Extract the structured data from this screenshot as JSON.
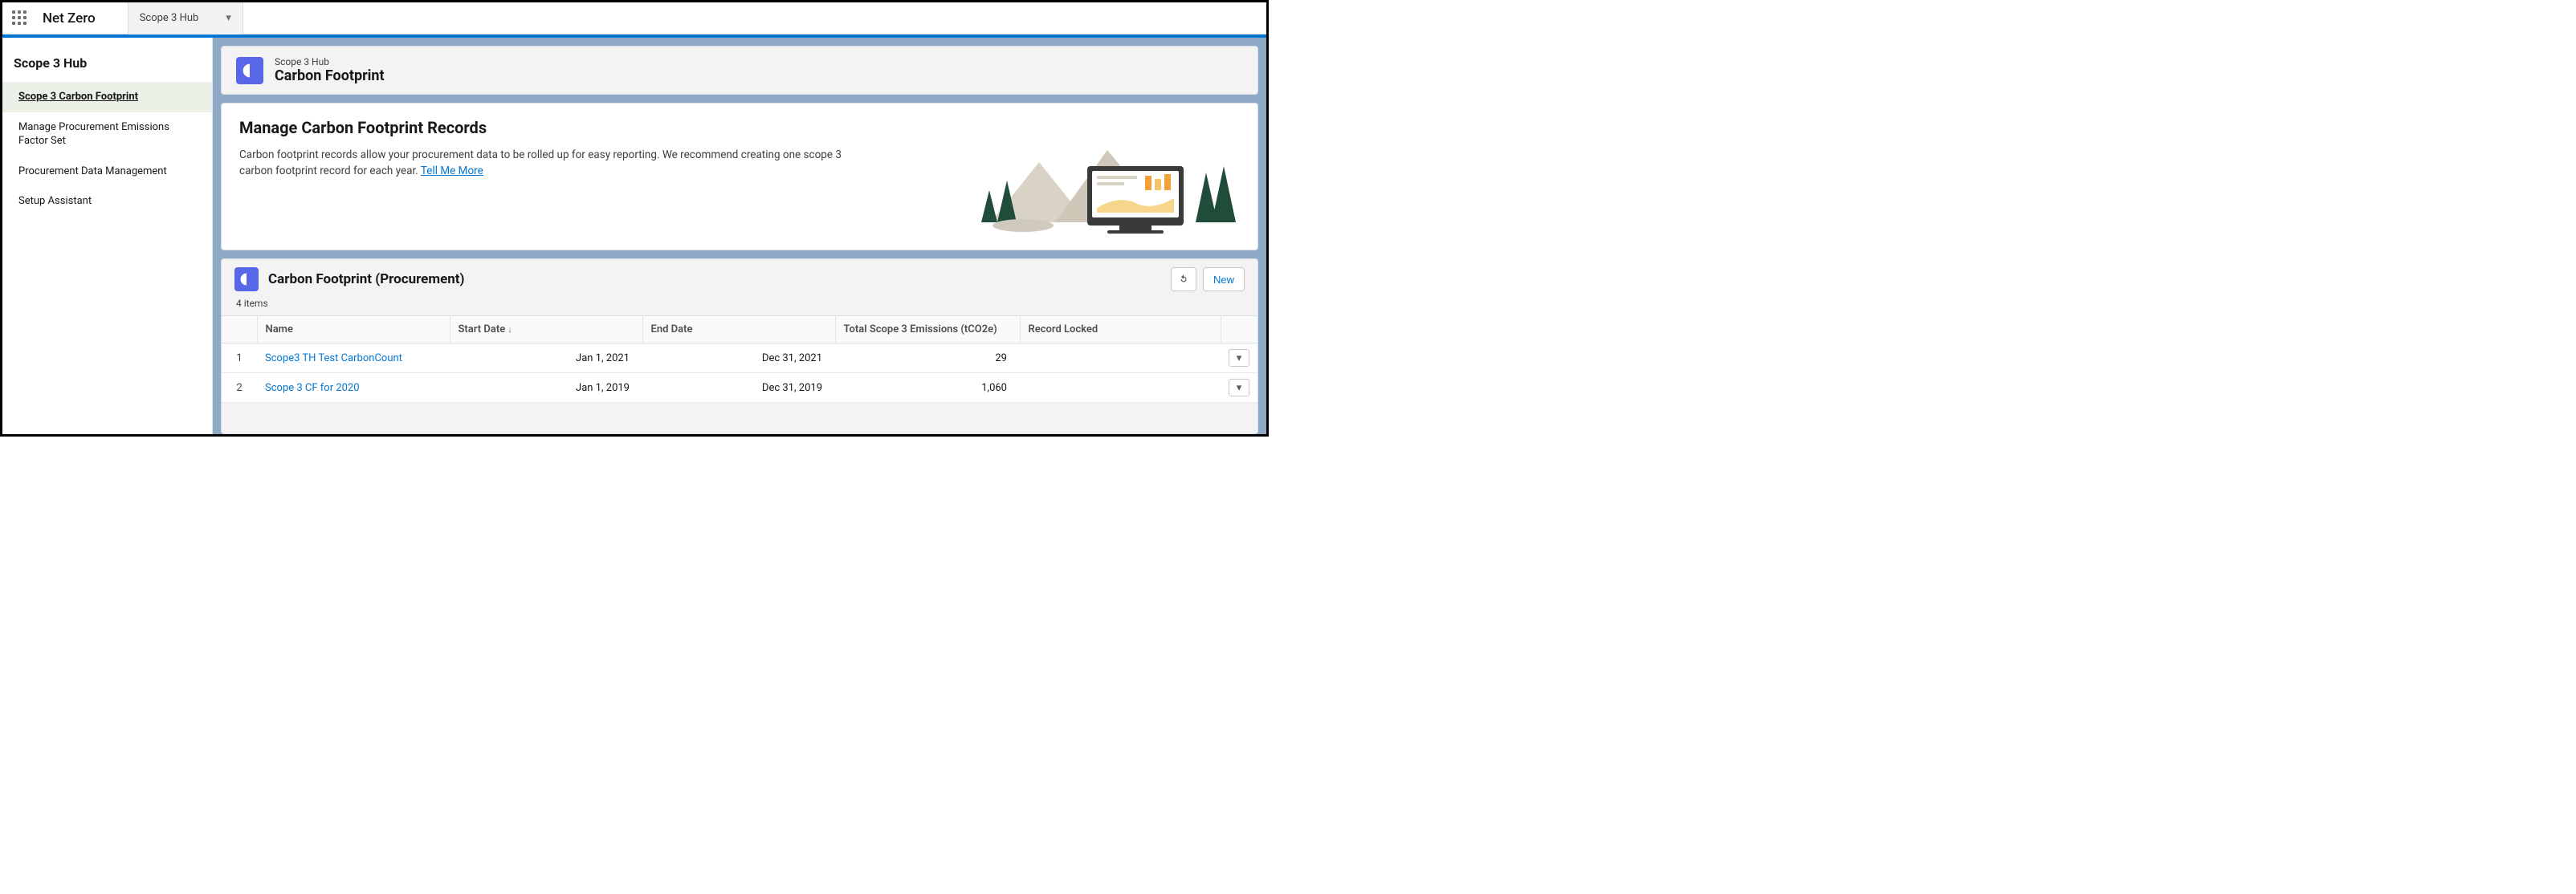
{
  "topbar": {
    "app_name": "Net Zero",
    "tab_label": "Scope 3 Hub"
  },
  "sidebar": {
    "title": "Scope 3 Hub",
    "items": [
      {
        "label": "Scope 3 Carbon Footprint",
        "active": true
      },
      {
        "label": "Manage Procurement Emissions Factor Set",
        "active": false
      },
      {
        "label": "Procurement Data Management",
        "active": false
      },
      {
        "label": "Setup Assistant",
        "active": false
      }
    ]
  },
  "header": {
    "context": "Scope 3 Hub",
    "title": "Carbon Footprint"
  },
  "info": {
    "heading": "Manage Carbon Footprint Records",
    "body_prefix": "Carbon footprint records allow your procurement data to be rolled up for easy reporting. We recommend creating one scope 3 carbon footprint record for each year. ",
    "link_text": "Tell Me More"
  },
  "list": {
    "title": "Carbon Footprint (Procurement)",
    "new_label": "New",
    "count_text": "4 items",
    "columns": {
      "name": "Name",
      "start": "Start Date",
      "end": "End Date",
      "emissions": "Total Scope 3 Emissions (tCO2e)",
      "locked": "Record Locked"
    },
    "rows": [
      {
        "idx": "1",
        "name": "Scope3 TH Test CarbonCount",
        "start": "Jan 1, 2021",
        "end": "Dec 31, 2021",
        "emissions": "29",
        "locked": ""
      },
      {
        "idx": "2",
        "name": "Scope 3 CF for 2020",
        "start": "Jan 1, 2019",
        "end": "Dec 31, 2019",
        "emissions": "1,060",
        "locked": ""
      }
    ]
  }
}
